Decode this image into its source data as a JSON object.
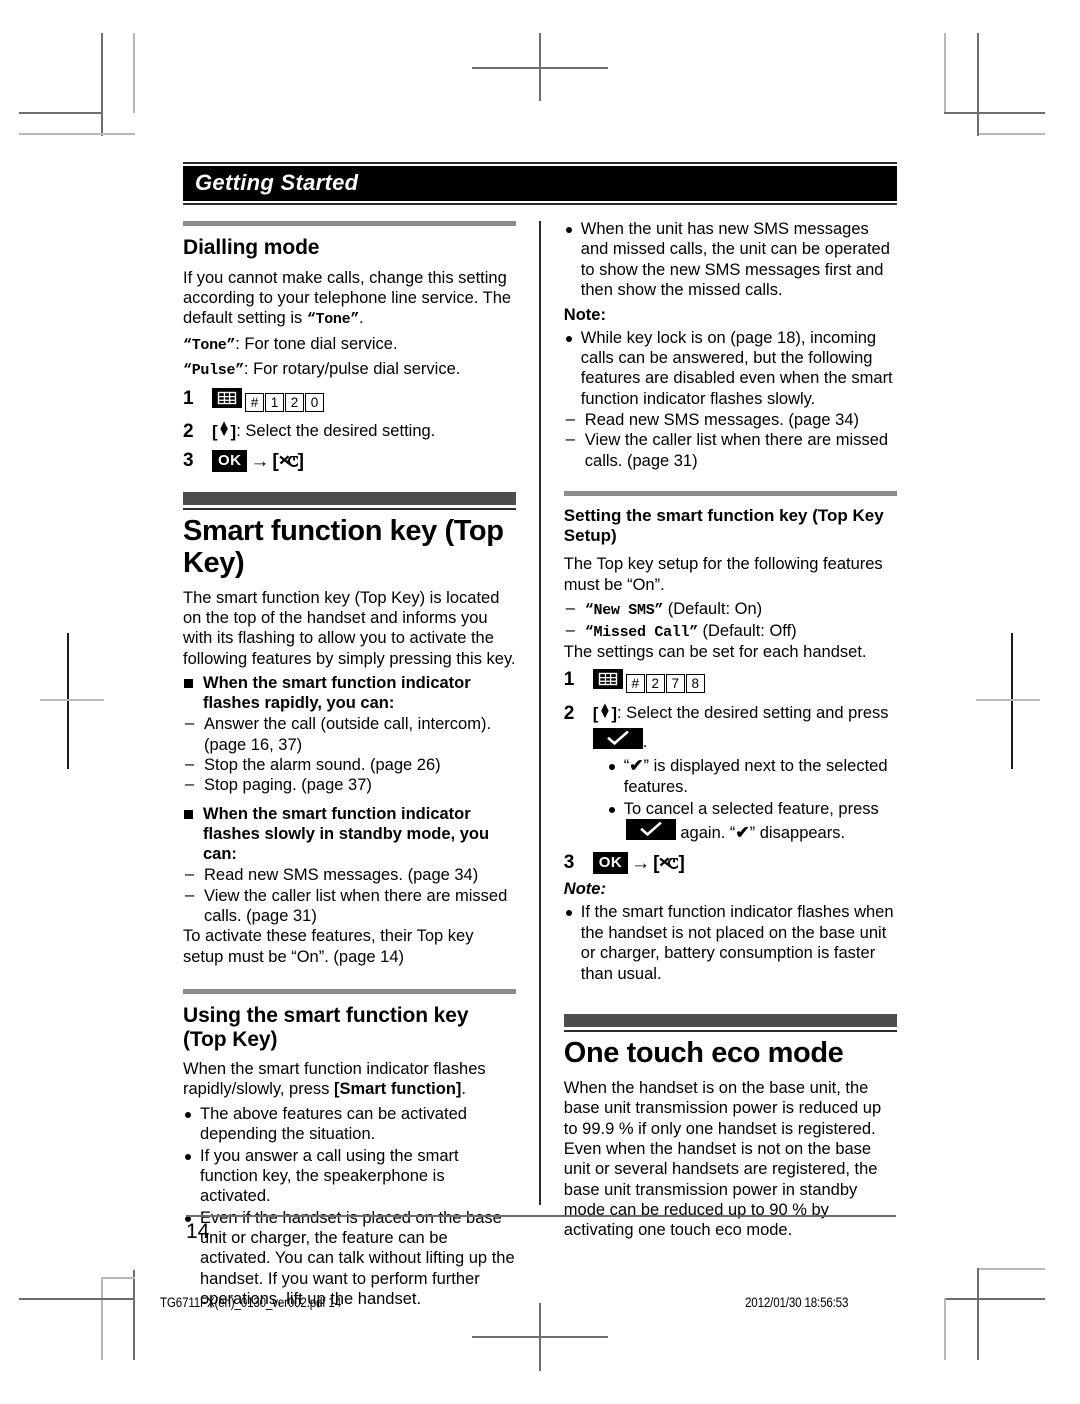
{
  "chapter": {
    "title": "Getting Started"
  },
  "footer": {
    "folio": "14",
    "imprint_left": "TG6711FX(en)_0130_ver002.pdf     14",
    "imprint_right": "2012/01/30      18:56:53"
  },
  "left_column": {
    "dialling_mode": {
      "heading": "Dialling mode",
      "intro_1": "If you cannot make calls, change this setting according to your telephone line service. The default setting is ",
      "intro_tone_quoted": "“Tone”",
      "intro_1_end": ".",
      "tone_line_key": "“Tone”",
      "tone_line_text": ": For tone dial service.",
      "pulse_line_key": "“Pulse”",
      "pulse_line_text": ": For rotary/pulse dial service.",
      "steps": [
        {
          "num": "1",
          "keys": [
            "keypad-icon",
            "#",
            "1",
            "2",
            "0"
          ]
        },
        {
          "num": "2",
          "text": ": Select the desired setting."
        },
        {
          "num": "3",
          "text": ""
        }
      ]
    },
    "smart_function_key": {
      "heading": "Smart function key (Top Key)",
      "intro": "The smart function key (Top Key) is located on the top of the handset and informs you with its flashing to allow you to activate the following features by simply pressing this key.",
      "block_rapid": {
        "title": "When the smart function indicator flashes rapidly, you can:",
        "items": [
          "Answer the call (outside call, intercom). (page 16, 37)",
          "Stop the alarm sound. (page 26)",
          "Stop paging. (page 37)"
        ]
      },
      "block_slow": {
        "title": "When the smart function indicator flashes slowly in standby mode, you can:",
        "items": [
          "Read new SMS messages. (page 34)",
          "View the caller list when there are missed calls. (page 31)"
        ],
        "trailer": "To activate these features, their Top key setup must be “On”. (page 14)"
      }
    },
    "using_smart_function_key": {
      "heading": "Using the smart function key (Top Key)",
      "intro_a": "When the smart function indicator flashes rapidly/slowly, press ",
      "intro_b": "[Smart function]",
      "intro_c": ".",
      "bullets": [
        "The above features can be activated depending the situation.",
        "If you answer a call using the smart function key, the speakerphone is activated.",
        "Even if the handset is placed on the base unit or charger, the feature can be activated. You can talk without lifting up the handset. If you want to perform further operations, lift up the handset."
      ]
    }
  },
  "right_column": {
    "top_bullets": [
      "When the unit has new SMS messages and missed calls, the unit can be operated to show the new SMS messages first and then show the missed calls."
    ],
    "note_label_1": "Note:",
    "note_1": {
      "bullet": "While key lock is on (page 18), incoming calls can be answered, but the following features are disabled even when the smart function indicator flashes slowly.",
      "sub_items": [
        "Read new SMS messages. (page 34)",
        "View the caller list when there are missed calls. (page 31)"
      ]
    },
    "top_key_setup": {
      "heading": "Setting the smart function key (Top Key Setup)",
      "intro": "The Top key setup for the following features must be “On”.",
      "feature_1_key": "“New SMS”",
      "feature_1_text": " (Default: On)",
      "feature_2_key": "“Missed Call”",
      "feature_2_text": " (Default: Off)",
      "intro_2": "The settings can be set for each handset.",
      "steps": [
        {
          "num": "1",
          "keys": [
            "keypad-icon",
            "#",
            "2",
            "7",
            "8"
          ]
        },
        {
          "num": "2",
          "text": ": Select the desired setting and press"
        },
        {
          "num": "3",
          "text": ""
        }
      ],
      "step2_subdots": [
        {
          "a": "“",
          "tick": "✔",
          "b": "” is displayed next to the selected features."
        },
        {
          "a": "To cancel a selected feature, press",
          "b": " again. “",
          "tick": "✔",
          "c": "” disappears."
        }
      ],
      "note_label": "Note:",
      "note_bullet": "If the smart function indicator flashes when the handset is not placed on the base unit or charger, battery consumption is faster than usual."
    },
    "one_touch_eco": {
      "heading": "One touch eco mode",
      "body": "When the handset is on the base unit, the base unit transmission power is reduced up to 99.9 % if only one handset is registered. Even when the handset is not on the base unit or several handsets are registered, the base unit transmission power in standby mode can be reduced up to 90 % by activating one touch eco mode."
    }
  },
  "icons": {
    "keypad": "keypad-icon",
    "hash": "#",
    "ok": "OK",
    "arrow": "→",
    "power_off": "power-off-icon",
    "navigator": "navigator-key-icon",
    "check": "check-key-icon"
  }
}
